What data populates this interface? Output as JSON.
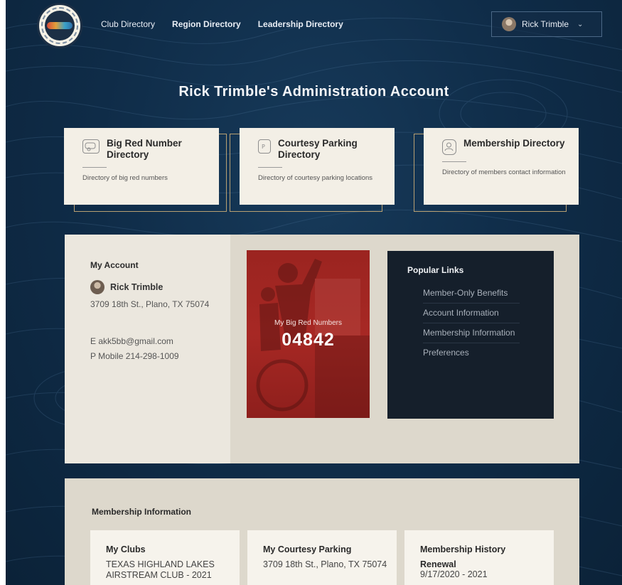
{
  "header": {
    "nav": [
      {
        "label": "Club Directory"
      },
      {
        "label": "Region Directory"
      },
      {
        "label": "Leadership Directory"
      }
    ],
    "user_menu": {
      "name": "Rick Trimble",
      "icon": "chevron-down-icon"
    }
  },
  "page_title": "Rick Trimble's Administration Account",
  "directory_cards": [
    {
      "title": "Big Red Number Directory",
      "description": "Directory of big red numbers",
      "icon": "rv-trailer-icon"
    },
    {
      "title": "Courtesy Parking Directory",
      "description": "Directory of courtesy parking locations",
      "icon": "parking-sign-icon"
    },
    {
      "title": "Membership Directory",
      "description": "Directory of members contact information",
      "icon": "contact-card-icon"
    }
  ],
  "account": {
    "heading": "My Account",
    "name": "Rick Trimble",
    "address": "3709 18th St., Plano, TX 75074",
    "email": "E akk5bb@gmail.com",
    "phone": "P Mobile 214-298-1009"
  },
  "big_red_numbers": {
    "label": "My Big Red Numbers",
    "number": "04842"
  },
  "popular_links": {
    "title": "Popular Links",
    "items": [
      "Member-Only Benefits",
      "Account Information",
      "Membership Information",
      "Preferences"
    ]
  },
  "membership_info": {
    "heading": "Membership Information",
    "cards": [
      {
        "title": "My Clubs",
        "value": "TEXAS HIGHLAND LAKES AIRSTREAM CLUB - 2021"
      },
      {
        "title": "My Courtesy Parking",
        "value": "3709 18th St., Plano, TX 75074"
      },
      {
        "title": "Membership History",
        "subtitle": "Renewal",
        "value": "9/17/2020 - 2021"
      }
    ]
  },
  "colors": {
    "background": "#0f2c48",
    "card": "#f3efe6",
    "accent_red": "#a72824",
    "panel_dark": "#151f2b",
    "panel_light": "#ddd8cc",
    "gold_border": "#b8a072"
  }
}
